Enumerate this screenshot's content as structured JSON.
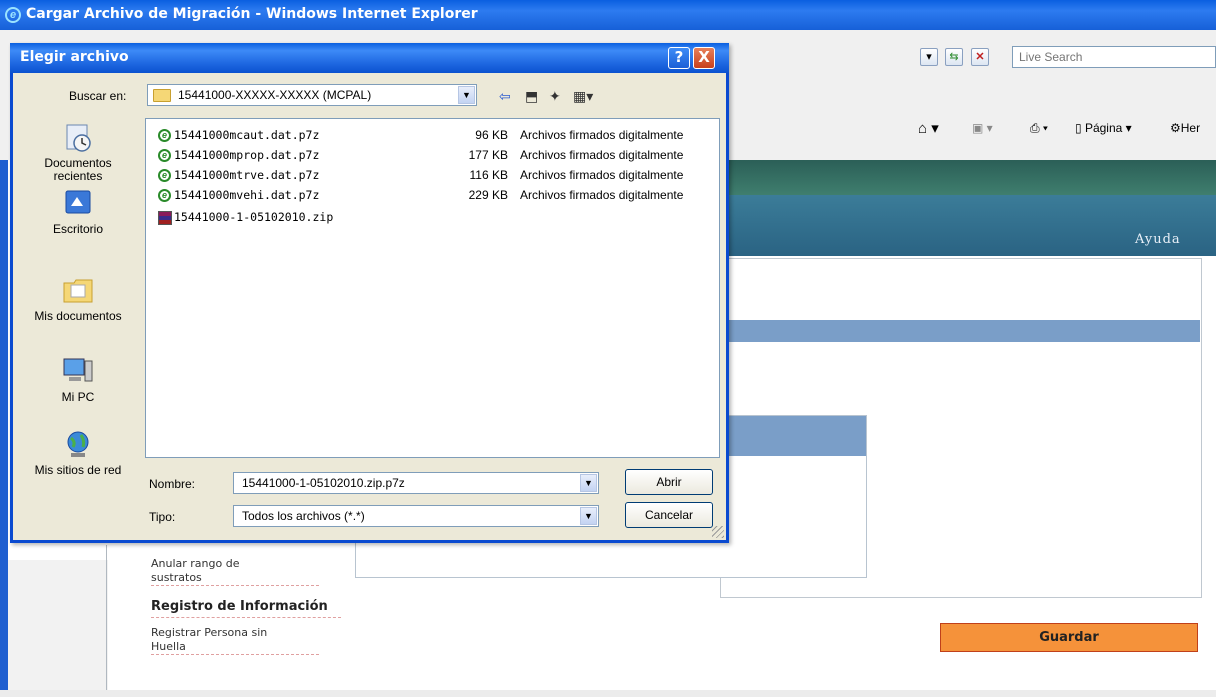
{
  "ie": {
    "title": "Cargar Archivo de Migración - Windows Internet Explorer",
    "search_placeholder": "Live Search",
    "cmd_pagina": "Página",
    "cmd_herramientas": "Her",
    "ayuda": "Ayuda"
  },
  "page": {
    "menu": {
      "anular_rango": [
        "Anular rango de",
        "sustratos"
      ],
      "section_registro": "Registro de Información",
      "registrar_persona": [
        "Registrar Persona sin",
        "Huella"
      ]
    },
    "guardar_label": "Guardar"
  },
  "dialog": {
    "title": "Elegir archivo",
    "lookin_label": "Buscar en:",
    "lookin_value": "15441000-XXXXX-XXXXX (MCPAL)",
    "places": [
      {
        "label": "Documentos recientes",
        "icon": "recent-documents-icon"
      },
      {
        "label": "Escritorio",
        "icon": "desktop-icon"
      },
      {
        "label": "Mis documentos",
        "icon": "my-documents-icon"
      },
      {
        "label": "Mi PC",
        "icon": "my-computer-icon"
      },
      {
        "label": "Mis sitios de red",
        "icon": "network-places-icon"
      }
    ],
    "files": [
      {
        "name": "15441000mcaut.dat.p7z",
        "size": "96 KB",
        "type": "Archivos firmados digitalmente",
        "icon": "signed-file-icon"
      },
      {
        "name": "15441000mprop.dat.p7z",
        "size": "177 KB",
        "type": "Archivos firmados digitalmente",
        "icon": "signed-file-icon"
      },
      {
        "name": "15441000mtrve.dat.p7z",
        "size": "116 KB",
        "type": "Archivos firmados digitalmente",
        "icon": "signed-file-icon"
      },
      {
        "name": "15441000mvehi.dat.p7z",
        "size": "229 KB",
        "type": "Archivos firmados digitalmente",
        "icon": "signed-file-icon"
      },
      {
        "name": "15441000-1-05102010.zip",
        "size": "",
        "type": "",
        "icon": "zip-archive-icon"
      }
    ],
    "nombre_label": "Nombre:",
    "nombre_value": "15441000-1-05102010.zip.p7z",
    "tipo_label": "Tipo:",
    "tipo_value": "Todos los archivos (*.*)",
    "abrir_label": "Abrir",
    "cancelar_label": "Cancelar",
    "help_label": "?",
    "close_label": "X"
  }
}
